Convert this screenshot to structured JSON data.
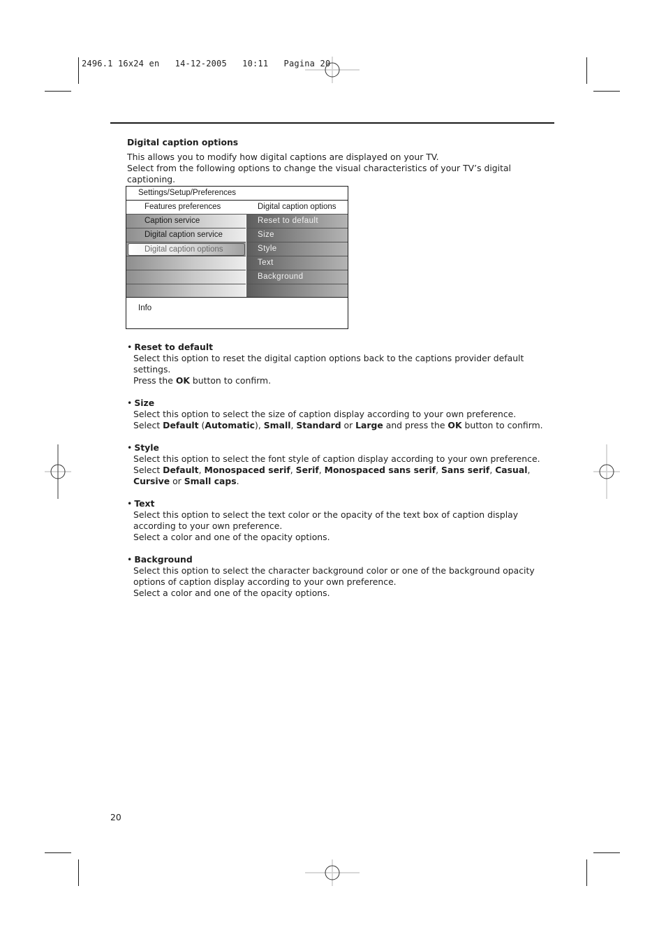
{
  "slug": "2496.1 16x24 en   14-12-2005   10:11   Pagina 20",
  "section": {
    "title": "Digital caption options",
    "intro": [
      "This allows you to modify how digital captions are displayed on your TV.",
      "Select from the following options to change the visual characteristics of your TV’s digital captioning."
    ]
  },
  "menu": {
    "path": "Settings/Setup/Preferences",
    "left_header": "Features preferences",
    "right_header": "Digital caption options",
    "left_items": [
      {
        "label": "Caption service",
        "selected": false
      },
      {
        "label": "Digital caption service",
        "selected": false
      },
      {
        "label": "Digital caption options",
        "selected": true
      },
      {
        "label": "",
        "selected": false
      },
      {
        "label": "",
        "selected": false
      },
      {
        "label": "",
        "selected": false
      }
    ],
    "right_items": [
      "Reset to default",
      "Size",
      "Style",
      "Text",
      "Background",
      ""
    ],
    "info_label": "Info"
  },
  "bullets": [
    {
      "title": "Reset to default",
      "lines": [
        [
          {
            "t": "Select this option to reset the digital caption options back to the captions provider default settings."
          }
        ],
        [
          {
            "t": "Press the "
          },
          {
            "t": "OK",
            "b": true
          },
          {
            "t": " button to confirm."
          }
        ]
      ]
    },
    {
      "title": "Size",
      "lines": [
        [
          {
            "t": "Select this option to select the size of caption display according to your own preference."
          }
        ],
        [
          {
            "t": "Select "
          },
          {
            "t": "Default",
            "b": true
          },
          {
            "t": " ("
          },
          {
            "t": "Automatic",
            "b": true
          },
          {
            "t": "), "
          },
          {
            "t": "Small",
            "b": true
          },
          {
            "t": ", "
          },
          {
            "t": "Standard",
            "b": true
          },
          {
            "t": " or "
          },
          {
            "t": "Large",
            "b": true
          },
          {
            "t": " and press the "
          },
          {
            "t": "OK",
            "b": true
          },
          {
            "t": " button to confirm."
          }
        ]
      ]
    },
    {
      "title": "Style",
      "lines": [
        [
          {
            "t": "Select this option to select the font style of caption display according to your own preference."
          }
        ],
        [
          {
            "t": "Select "
          },
          {
            "t": "Default",
            "b": true
          },
          {
            "t": ", "
          },
          {
            "t": "Monospaced serif",
            "b": true
          },
          {
            "t": ", "
          },
          {
            "t": "Serif",
            "b": true
          },
          {
            "t": ", "
          },
          {
            "t": "Monospaced sans serif",
            "b": true
          },
          {
            "t": ", "
          },
          {
            "t": "Sans serif",
            "b": true
          },
          {
            "t": ", "
          },
          {
            "t": "Casual",
            "b": true
          },
          {
            "t": ", "
          },
          {
            "t": "Cursive",
            "b": true
          },
          {
            "t": " or "
          },
          {
            "t": "Small caps",
            "b": true
          },
          {
            "t": "."
          }
        ]
      ]
    },
    {
      "title": "Text",
      "lines": [
        [
          {
            "t": "Select this option to select the text color or the opacity of the text box of caption display according to your own preference."
          }
        ],
        [
          {
            "t": "Select a color and one of the opacity options."
          }
        ]
      ]
    },
    {
      "title": "Background",
      "lines": [
        [
          {
            "t": "Select this option to select the character background color or one of the background opacity options of caption display according to your own preference."
          }
        ],
        [
          {
            "t": "Select a color and one of the opacity options."
          }
        ]
      ]
    }
  ],
  "page_number": "20"
}
